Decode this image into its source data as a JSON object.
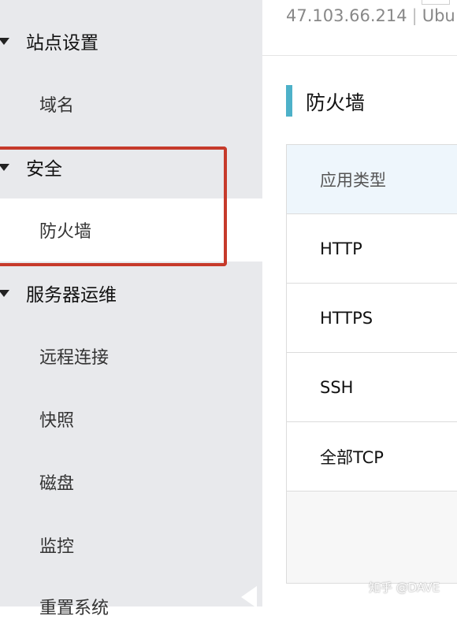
{
  "header": {
    "ip": "47.103.66.214",
    "os": "Ubu"
  },
  "sidebar": {
    "site_settings": "站点设置",
    "domain": "域名",
    "security": "安全",
    "firewall": "防火墙",
    "server_ops": "服务器运维",
    "remote_connect": "远程连接",
    "snapshot": "快照",
    "disk": "磁盘",
    "monitor": "监控",
    "reset_system": "重置系统"
  },
  "main": {
    "title": "防火墙",
    "table": {
      "header": "应用类型",
      "rows": [
        "HTTP",
        "HTTPS",
        "SSH",
        "全部TCP"
      ]
    }
  },
  "watermark": "知乎 @DAVE",
  "colors": {
    "highlight": "#c63a2b",
    "accent": "#4db1c9",
    "sidebar_bg": "#e8e9ec"
  }
}
